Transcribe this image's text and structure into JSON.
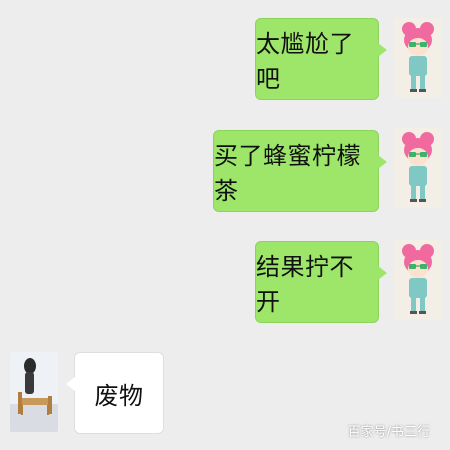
{
  "messages": [
    {
      "direction": "out",
      "text": "太尴尬了吧"
    },
    {
      "direction": "out",
      "text": "买了蜂蜜柠檬茶"
    },
    {
      "direction": "out",
      "text": "结果拧不开"
    },
    {
      "direction": "in",
      "text": "废物"
    }
  ],
  "watermark": "百家号/书三行",
  "avatars": {
    "self": "pink-hair-cartoon-avatar-icon",
    "contact": "bed-scene-avatar-icon"
  },
  "colors": {
    "background": "#ededed",
    "outgoing_bubble": "#9de66a",
    "incoming_bubble": "#ffffff"
  }
}
